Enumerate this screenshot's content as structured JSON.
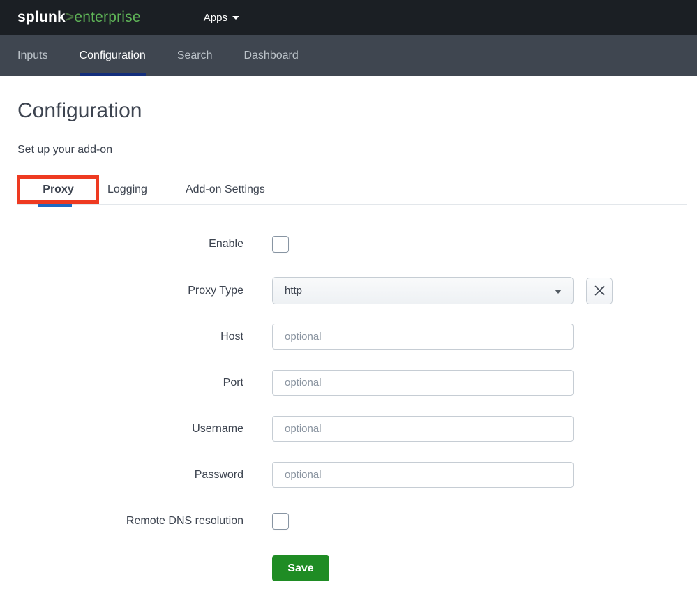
{
  "topbar": {
    "logo": {
      "brand": "splunk",
      "caret": ">",
      "product": "enterprise"
    },
    "apps": {
      "label": "Apps"
    }
  },
  "navbar": {
    "active": "Configuration",
    "items": [
      {
        "label": "Inputs"
      },
      {
        "label": "Configuration"
      },
      {
        "label": "Search"
      },
      {
        "label": "Dashboard"
      }
    ]
  },
  "page": {
    "title": "Configuration",
    "subtitle": "Set up your add-on"
  },
  "tabs": {
    "active": "Proxy",
    "annotated": "Proxy",
    "items": [
      {
        "label": "Proxy"
      },
      {
        "label": "Logging"
      },
      {
        "label": "Add-on Settings"
      }
    ]
  },
  "form": {
    "fields": [
      {
        "label": "Enable",
        "type": "checkbox",
        "checked": false
      },
      {
        "label": "Proxy Type",
        "type": "select",
        "value": "http",
        "clearable": true
      },
      {
        "label": "Host",
        "type": "text",
        "value": "",
        "placeholder": "optional"
      },
      {
        "label": "Port",
        "type": "text",
        "value": "",
        "placeholder": "optional"
      },
      {
        "label": "Username",
        "type": "text",
        "value": "",
        "placeholder": "optional"
      },
      {
        "label": "Password",
        "type": "password",
        "value": "",
        "placeholder": "optional"
      },
      {
        "label": "Remote DNS resolution",
        "type": "checkbox",
        "checked": false
      }
    ],
    "save_button": {
      "label": "Save"
    }
  },
  "icons": {
    "apps_caret": "caret-down-icon",
    "select_caret": "caret-down-icon",
    "clear": "close-icon"
  },
  "colors": {
    "topbar_bg": "#1b1f24",
    "navbar_bg": "#3f4650",
    "brand_green": "#5fb457",
    "logo_caret_green": "#47703f",
    "nav_active_underline": "#142f7c",
    "tab_active_underline": "#1f6ac2",
    "annotation_red": "#ee3a21",
    "save_green": "#1f8c24",
    "divider": "#e3e7eb"
  }
}
